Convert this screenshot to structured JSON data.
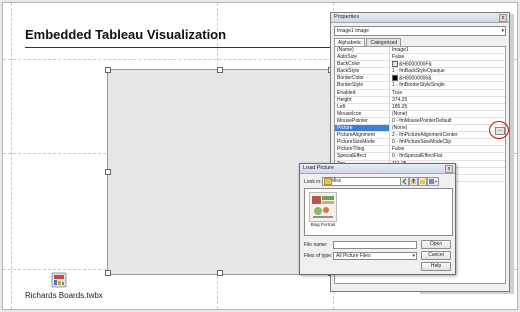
{
  "document": {
    "title": "Embedded Tableau Visualization",
    "workbook_label": "Richards Boards.twbx"
  },
  "properties": {
    "window_title": "Properties",
    "close_glyph": "x",
    "object_selector": "Image1 Image",
    "tabs": [
      {
        "label": "Alphabetic",
        "active": true
      },
      {
        "label": "Categorized",
        "active": false
      }
    ],
    "rows": [
      {
        "name": "(Name)",
        "value": "Image1"
      },
      {
        "name": "AutoSize",
        "value": "False"
      },
      {
        "name": "BackColor",
        "value": "&H8000000F&",
        "swatch": "#ece9d8"
      },
      {
        "name": "BackStyle",
        "value": "1 - fmBackStyleOpaque"
      },
      {
        "name": "BorderColor",
        "value": "&H80000006&",
        "swatch": "#000000"
      },
      {
        "name": "BorderStyle",
        "value": "1 - fmBorderStyleSingle"
      },
      {
        "name": "Enabled",
        "value": "True"
      },
      {
        "name": "Height",
        "value": "374.25"
      },
      {
        "name": "Left",
        "value": "185.25"
      },
      {
        "name": "MouseIcon",
        "value": "(None)"
      },
      {
        "name": "MousePointer",
        "value": "0 - fmMousePointerDefault"
      },
      {
        "name": "Picture",
        "value": "(None)",
        "selected": true
      },
      {
        "name": "PictureAlignment",
        "value": "2 - fmPictureAlignmentCenter"
      },
      {
        "name": "PictureSizeMode",
        "value": "0 - fmPictureSizeModeClip"
      },
      {
        "name": "PictureTiling",
        "value": "False"
      },
      {
        "name": "SpecialEffect",
        "value": "0 - fmSpecialEffectFlat"
      },
      {
        "name": "Top",
        "value": "111.25"
      },
      {
        "name": "Visible",
        "value": "True"
      },
      {
        "name": "Width",
        "value": "413.875"
      }
    ],
    "ellipsis_label": "..."
  },
  "load_picture": {
    "title": "Load Picture",
    "close_glyph": "x",
    "look_in_label": "Look in:",
    "look_in_value": "Misc",
    "file": {
      "name": "Blog Portrait"
    },
    "file_name_label": "File name:",
    "file_name_value": "",
    "file_type_label": "Files of type:",
    "file_type_value": "All Picture Files",
    "buttons": {
      "open": "Open",
      "cancel": "Cancel",
      "help": "Help"
    }
  },
  "colors": {
    "selection": "#3d7fd3",
    "annotation": "#d01010",
    "folder": "#e3c363"
  }
}
